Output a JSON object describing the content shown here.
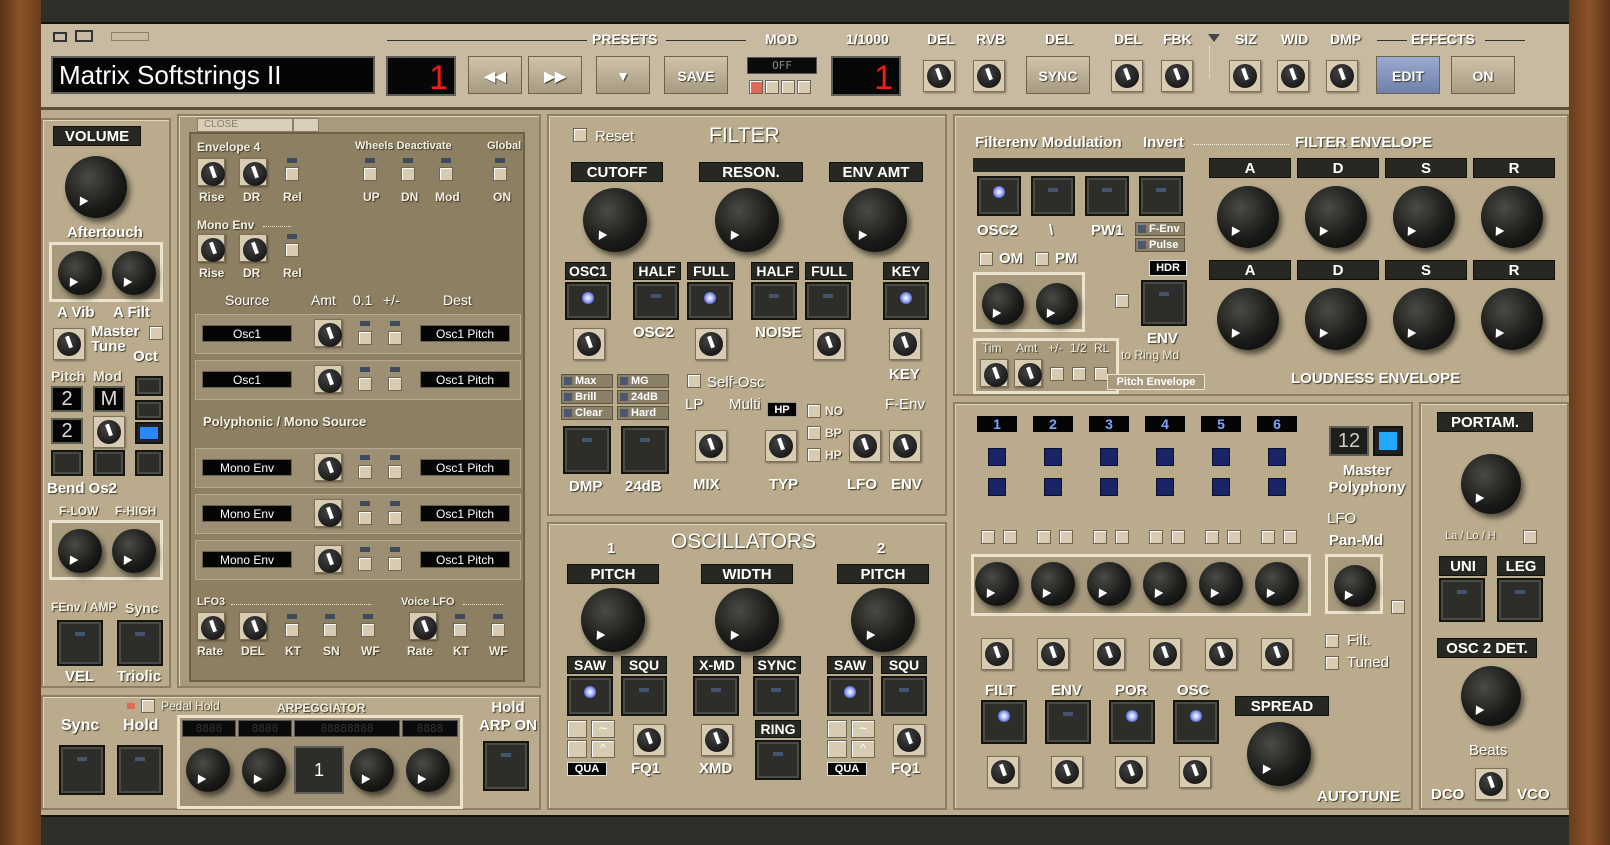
{
  "header": {
    "preset_name": "Matrix Softstrings II",
    "preset_bank": "1",
    "preset_num": "1",
    "presets_label": "PRESETS",
    "mod_label": "MOD",
    "mod_display": "OFF",
    "range_label": "1/1000",
    "rewind_label": "◀◀",
    "forward_label": "▶▶",
    "down_label": "▼",
    "save_label": "SAVE",
    "sync_label": "SYNC",
    "edit_label": "EDIT",
    "on_label": "ON",
    "del_label": "DEL",
    "rvb_label": "RVB",
    "del2_label": "DEL",
    "del3_label": "DEL",
    "fbk_label": "FBK",
    "siz_label": "SIZ",
    "wid_label": "WID",
    "dmp_label": "DMP",
    "effects_label": "EFFECTS"
  },
  "volume": {
    "title": "VOLUME",
    "aftertouch": "Aftertouch",
    "avib": "A Vib",
    "afilt": "A Filt",
    "master_tune": "Master Tune",
    "oct": "Oct",
    "pitch": "Pitch",
    "mod": "Mod",
    "pitch_val1": "2",
    "mod_val1": "M",
    "pitch_val2": "2",
    "bend_os2": "Bend Os2",
    "flow": "F-LOW",
    "fhigh": "F-HIGH",
    "fenv_amp": "FEnv / AMP",
    "sync": "Sync",
    "vel": "VEL",
    "triolic": "Triolic"
  },
  "mod": {
    "close": "CLOSE",
    "envelope4": "Envelope 4",
    "rise": "Rise",
    "dr": "DR",
    "rel": "Rel",
    "wheels": "Wheels Deactivate",
    "global": "Global",
    "up": "UP",
    "dn": "DN",
    "modl": "Mod",
    "on": "ON",
    "mono_env": "Mono  Env",
    "rise2": "Rise",
    "dr2": "DR",
    "rel2": "Rel",
    "source": "Source",
    "amt": "Amt",
    "p01": "0.1",
    "pm": "+/-",
    "dest": "Dest",
    "rows": [
      {
        "src": "Osc1",
        "dst": "Osc1 Pitch"
      },
      {
        "src": "Osc1",
        "dst": "Osc1 Pitch"
      }
    ],
    "poly_mono": "Polyphonic / Mono Source",
    "mono_rows": [
      {
        "src": "Mono Env",
        "dst": "Osc1 Pitch"
      },
      {
        "src": "Mono Env",
        "dst": "Osc1 Pitch"
      },
      {
        "src": "Mono Env",
        "dst": "Osc1 Pitch"
      }
    ],
    "lfo3": "LFO3",
    "rate": "Rate",
    "del": "DEL",
    "kt": "KT",
    "sn": "SN",
    "wf": "WF",
    "voice_lfo": "Voice LFO",
    "vrate": "Rate",
    "vkt": "KT",
    "vwf": "WF"
  },
  "arp": {
    "sync": "Sync",
    "hold": "Hold",
    "pedal_hold": "Pedal Hold",
    "title": "ARPEGGIATOR",
    "hold_arp": "Hold ARP ON",
    "display": "1"
  },
  "filter": {
    "reset": "Reset",
    "title": "FILTER",
    "cutoff": "CUTOFF",
    "reson": "RESON.",
    "envamt": "ENV AMT",
    "osc1": "OSC1",
    "half": "HALF",
    "full": "FULL",
    "half2": "HALF",
    "full2": "FULL",
    "key": "KEY",
    "osc2": "OSC2",
    "noise": "NOISE",
    "key2": "KEY",
    "max": "Max",
    "mg": "MG",
    "brill": "Brill",
    "db24": "24dB",
    "clear": "Clear",
    "hard": "Hard",
    "self_osc": "Self-Osc",
    "lp": "LP",
    "multi": "Multi",
    "hp": "HP",
    "no": "NO",
    "bp": "BP",
    "hp2": "HP",
    "fenv": "F-Env",
    "dmp": "DMP",
    "db24b": "24dB",
    "mix": "MIX",
    "typ": "TYP",
    "lfo": "LFO",
    "env": "ENV"
  },
  "osc": {
    "title": "OSCILLATORS",
    "n1": "1",
    "n2": "2",
    "pitch": "PITCH",
    "width": "WIDTH",
    "pitch2": "PITCH",
    "saw": "SAW",
    "squ": "SQU",
    "xmd": "X-MD",
    "sync": "SYNC",
    "saw2": "SAW",
    "squ2": "SQU",
    "ring": "RING",
    "qua": "QUA",
    "fq1": "FQ1",
    "xmd2": "XMD",
    "qua2": "QUA",
    "fq12": "FQ1"
  },
  "fenvmod": {
    "title": "Filterenv Modulation",
    "invert": "Invert",
    "filter_env": "FILTER ENVELOPE",
    "a": "A",
    "d": "D",
    "s": "S",
    "r": "R",
    "osc2": "OSC2",
    "backslash": "\\",
    "pw1": "PW1",
    "fenv": "F-Env",
    "pulse": "Pulse",
    "om": "OM",
    "pm": "PM",
    "hdr": "HDR",
    "env": "ENV",
    "to_ring": "to Ring Md",
    "tim": "Tim",
    "amt": "Amt",
    "pm2": "+/-",
    "half": "1/2",
    "rl": "RL",
    "pitch_env": "Pitch Envelope",
    "a2": "A",
    "d2": "D",
    "s2": "S",
    "r2": "R",
    "loud_env": "LOUDNESS ENVELOPE"
  },
  "voices": {
    "nums": [
      "1",
      "2",
      "3",
      "4",
      "5",
      "6"
    ],
    "poly": "12",
    "master_poly": "Master Polyphony",
    "lfo": "LFO",
    "pan_md": "Pan-Md",
    "filt": "Filt.",
    "tuned": "Tuned",
    "filt_btn": "FILT",
    "env_btn": "ENV",
    "por_btn": "POR",
    "osc_btn": "OSC",
    "spread": "SPREAD",
    "autotune": "AUTOTUNE"
  },
  "portam": {
    "title": "PORTAM.",
    "lalo": "La / Lo / H",
    "uni": "UNI",
    "leg": "LEG",
    "osc2det": "OSC 2 DET.",
    "beats": "Beats",
    "dco": "DCO",
    "vco": "VCO"
  }
}
